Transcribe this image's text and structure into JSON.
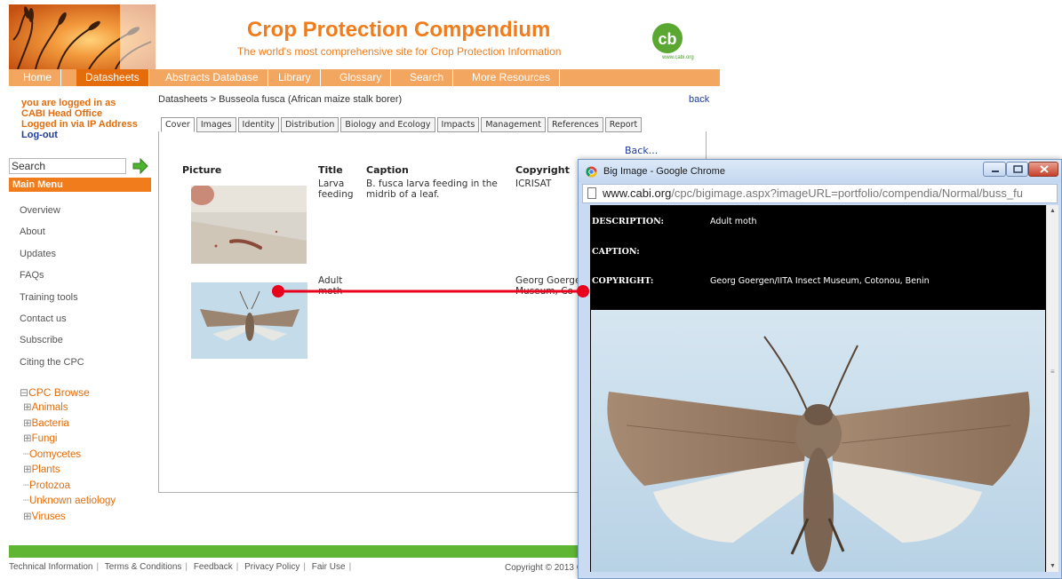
{
  "header": {
    "title": "Crop Protection Compendium",
    "tagline": "The world's most comprehensive site for Crop Protection Information",
    "logo_url_text": "www.cabi.org"
  },
  "topnav": [
    "Home",
    "Datasheets",
    "Abstracts Database",
    "Library",
    "Glossary",
    "Search",
    "More Resources"
  ],
  "login": {
    "line1": "you are logged in as",
    "line2": "CABI Head Office",
    "line3": "Logged in via IP Address",
    "logout": "Log-out"
  },
  "search": {
    "value": "Search"
  },
  "main_menu": {
    "heading": "Main Menu",
    "items": [
      "Overview",
      "About",
      "Updates",
      "FAQs",
      "Training tools",
      "Contact us",
      "Subscribe",
      "Citing the CPC"
    ]
  },
  "browse": {
    "heading": "CPC Browse",
    "items": [
      "Animals",
      "Bacteria",
      "Fungi",
      "Oomycetes",
      "Plants",
      "Protozoa",
      "Unknown aetiology",
      "Viruses"
    ]
  },
  "content": {
    "breadcrumb": "Datasheets > Busseola fusca (African maize stalk borer)",
    "back": "back",
    "back_small": "Back...",
    "tabs": [
      "Cover",
      "Images",
      "Identity",
      "Distribution",
      "Biology and Ecology",
      "Impacts",
      "Management",
      "References",
      "Report"
    ],
    "columns": [
      "Picture",
      "Title",
      "Caption",
      "Copyright"
    ],
    "rows": [
      {
        "title_l1": "Larva",
        "title_l2": "feeding",
        "caption_l1": "B. fusca larva feeding in the",
        "caption_l2": "midrib of a leaf.",
        "copyright_l1": "ICRISAT",
        "copyright_l2": ""
      },
      {
        "title_l1": "Adult",
        "title_l2": "moth",
        "caption_l1": "",
        "caption_l2": "",
        "copyright_l1": "Georg Goerge",
        "copyright_l2": "Museum, Co"
      }
    ]
  },
  "footer": {
    "links": [
      "Technical Information",
      "Terms & Conditions",
      "Feedback",
      "Privacy Policy",
      "Fair Use"
    ],
    "copyright": "Copyright © 2013 CA"
  },
  "popup": {
    "window_title": "Big Image - Google Chrome",
    "url_host": "www.cabi.org",
    "url_path": "/cpc/bigimage.aspx?imageURL=portfolio/compendia/Normal/buss_fu",
    "description_label": "DESCRIPTION:",
    "description_value": "Adult moth",
    "caption_label": "CAPTION:",
    "caption_value": "",
    "copyright_label": "COPYRIGHT:",
    "copyright_value": "Georg Goergen/IITA Insect Museum, Cotonou, Benin"
  },
  "colors": {
    "brand_orange": "#f07c1b",
    "nav_orange": "#f2a660",
    "footer_green": "#5fb634",
    "link_blue": "#1f3c9a",
    "annotation_red": "#e8001c"
  }
}
